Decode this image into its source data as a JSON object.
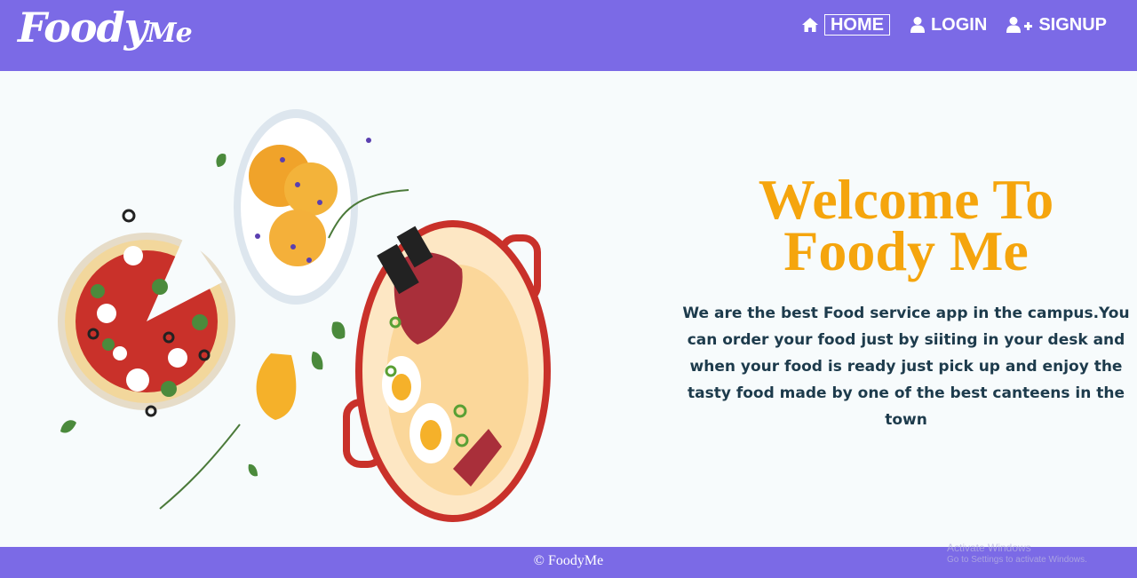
{
  "brand": {
    "main": "Foody",
    "suffix": "Me"
  },
  "nav": {
    "home": {
      "label": "HOME",
      "icon": "home-icon"
    },
    "login": {
      "label": "LOGIN",
      "icon": "user-icon"
    },
    "signup": {
      "label": "SIGNUP",
      "icon": "user-plus-icon"
    }
  },
  "hero": {
    "title": "Welcome To Foody Me",
    "description": "We are the best Food service app in the campus.You can order your food just by siiting in your desk and when your food is ready just pick up and enjoy the tasty food made by one of the best canteens in the town"
  },
  "footer": {
    "text": "© FoodyMe"
  },
  "watermark": {
    "title": "Activate Windows",
    "subtitle": "Go to Settings to activate Windows."
  },
  "colors": {
    "nav_bg": "#7b6ae6",
    "title": "#f5a50d",
    "text": "#1d3b4c"
  }
}
